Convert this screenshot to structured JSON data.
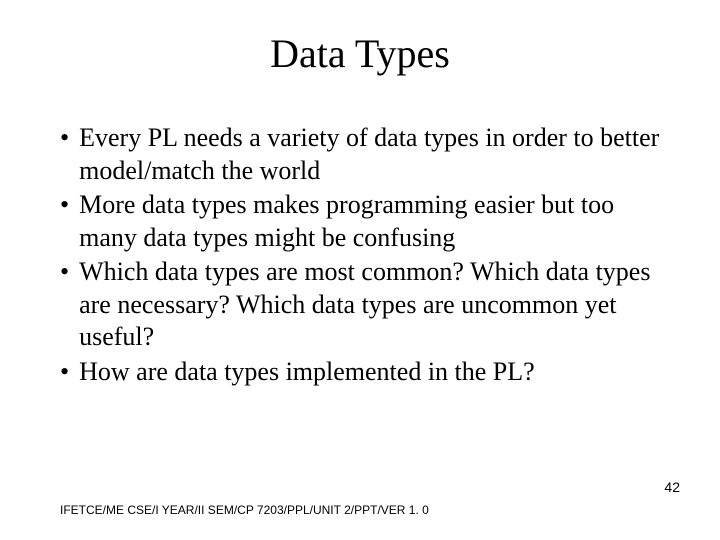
{
  "slide": {
    "title": "Data Types",
    "bullets": [
      "Every PL needs a variety of data types in order to better model/match the world",
      "More data types makes programming easier but too many data types might be confusing",
      "Which data types are most common?  Which data types are necessary?  Which data types are uncommon yet useful?",
      "How are data types implemented in the PL?"
    ],
    "footer": "IFETCE/ME CSE/I YEAR/II SEM/CP 7203/PPL/UNIT 2/PPT/VER 1. 0",
    "page_number": "42"
  }
}
